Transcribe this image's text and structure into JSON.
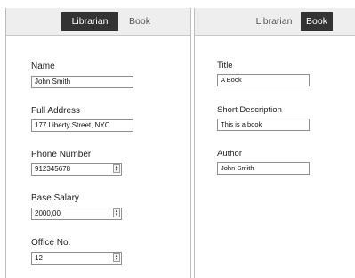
{
  "left_panel": {
    "tabs": [
      {
        "label": "Librarian",
        "active": true
      },
      {
        "label": "Book",
        "active": false
      }
    ],
    "fields": {
      "name": {
        "label": "Name",
        "value": "John Smith"
      },
      "full_address": {
        "label": "Full Address",
        "value": "177 Liberty Street, NYC"
      },
      "phone_number": {
        "label": "Phone Number",
        "value": "912345678"
      },
      "base_salary": {
        "label": "Base Salary",
        "value": "2000,00"
      },
      "office_no": {
        "label": "Office No.",
        "value": "12"
      }
    }
  },
  "right_panel": {
    "tabs": [
      {
        "label": "Librarian",
        "active": false
      },
      {
        "label": "Book",
        "active": true
      }
    ],
    "fields": {
      "title": {
        "label": "Title",
        "value": "A Book"
      },
      "short_description": {
        "label": "Short Description",
        "value": "This is a book"
      },
      "author": {
        "label": "Author",
        "value": "John Smith"
      }
    }
  },
  "colors": {
    "active_tab_bg": "#333333",
    "tabbar_bg": "#eeeeee",
    "panel_border": "#bdbdbd"
  },
  "icons": {
    "stepper": "up-down-stepper-icon"
  }
}
